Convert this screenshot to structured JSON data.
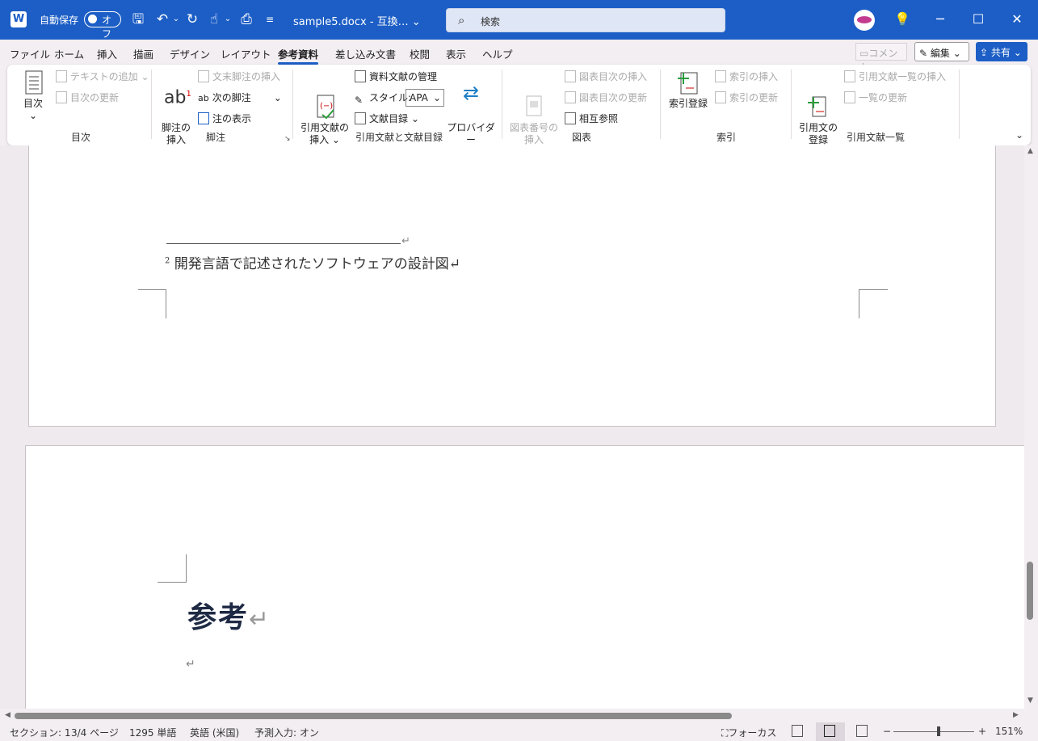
{
  "titlebar": {
    "app_logo": "W",
    "autosave_label": "自動保存",
    "autosave_state": "オフ",
    "doc_title": "sample5.docx  -  互換… ⌄",
    "search_placeholder": "検索",
    "icons": [
      "save-icon",
      "undo-icon",
      "redo-icon",
      "touch-mode-icon",
      "customize-icon"
    ]
  },
  "menu": {
    "tabs": [
      "ファイル",
      "ホーム",
      "挿入",
      "描画",
      "デザイン",
      "レイアウト",
      "参考資料",
      "差し込み文書",
      "校閲",
      "表示",
      "ヘルプ"
    ],
    "active_tab": "参考資料",
    "comment_label": "コメント",
    "edit_label": "編集 ⌄",
    "share_label": "共有 ⌄"
  },
  "ribbon": {
    "toc": {
      "label": "目次",
      "big_label": "目次",
      "add_text": "テキストの追加 ⌄",
      "update": "目次の更新"
    },
    "footnotes": {
      "label": "脚注",
      "insert": "脚注の\n挿入",
      "endnote": "文末脚注の挿入",
      "next": "次の脚注",
      "show": "注の表示"
    },
    "citations": {
      "label": "引用文献と文献目録",
      "insert": "引用文献の\n挿入 ⌄",
      "manage": "資料文献の管理",
      "style_label": "スタイル:",
      "style_value": "APA",
      "bibliography": "文献目録 ⌄",
      "provider": "プロバイダー\nの変更 ⌄"
    },
    "captions": {
      "label": "図表",
      "insert": "図表番号の\n挿入",
      "tof_insert": "図表目次の挿入",
      "tof_update": "図表目次の更新",
      "cross_ref": "相互参照"
    },
    "index": {
      "label": "索引",
      "mark": "索引登録",
      "insert": "索引の挿入",
      "update": "索引の更新"
    },
    "toa": {
      "label": "引用文献一覧",
      "mark": "引用文の\n登録",
      "insert": "引用文献一覧の挿入",
      "update": "一覧の更新"
    }
  },
  "document": {
    "footnote_number": "2",
    "footnote_text": " 開発言語で記述されたソフトウェアの設計図↵",
    "heading": "参考",
    "heading_mark": "↵",
    "para_mark": "↵",
    "line_mark": "↵"
  },
  "status": {
    "section": "セクション: 1",
    "page": "3/4 ページ",
    "words": "1295 単語",
    "language": "英語 (米国)",
    "predict": "予測入力: オン",
    "focus": "フォーカス",
    "zoom_minus": "−",
    "zoom_plus": "+",
    "zoom": "151%"
  }
}
